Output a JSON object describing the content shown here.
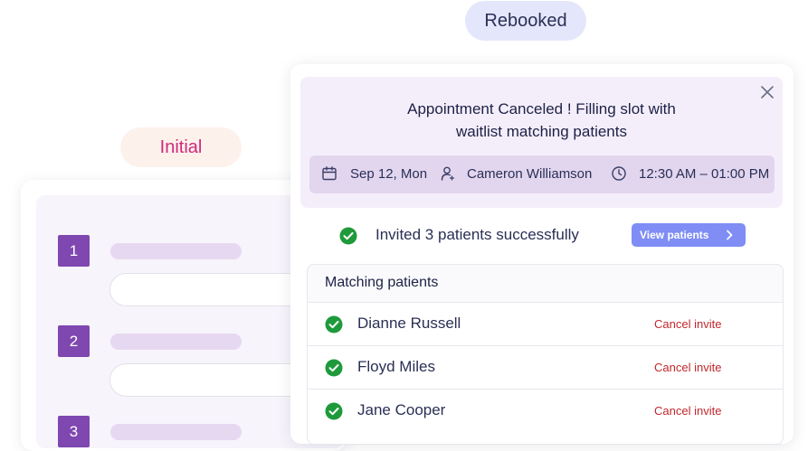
{
  "labels": {
    "rebooked": "Rebooked",
    "initial": "Initial"
  },
  "steps": [
    "1",
    "2",
    "3"
  ],
  "alert": {
    "title_line1": "Appointment Canceled ! Filling slot with",
    "title_line2": "waitlist matching patients",
    "date": "Sep 12, Mon",
    "patient": "Cameron Williamson",
    "time": "12:30 AM – 01:00 PM"
  },
  "status": {
    "message": "Invited 3 patients successfully",
    "view_button": "View patients"
  },
  "matching": {
    "title": "Matching patients",
    "rows": [
      {
        "name": "Dianne Russell",
        "action": "Cancel invite"
      },
      {
        "name": "Floyd Miles",
        "action": "Cancel invite"
      },
      {
        "name": "Jane Cooper",
        "action": "Cancel invite"
      }
    ]
  },
  "colors": {
    "accent": "#7f8df5",
    "step": "#7f47b0",
    "success": "#1f9a3b",
    "danger": "#c0282d",
    "initial": "#d1297a"
  },
  "icons": [
    "close-icon",
    "calendar-icon",
    "user-icon",
    "clock-icon",
    "check-circle-icon",
    "chevron-right-icon"
  ]
}
